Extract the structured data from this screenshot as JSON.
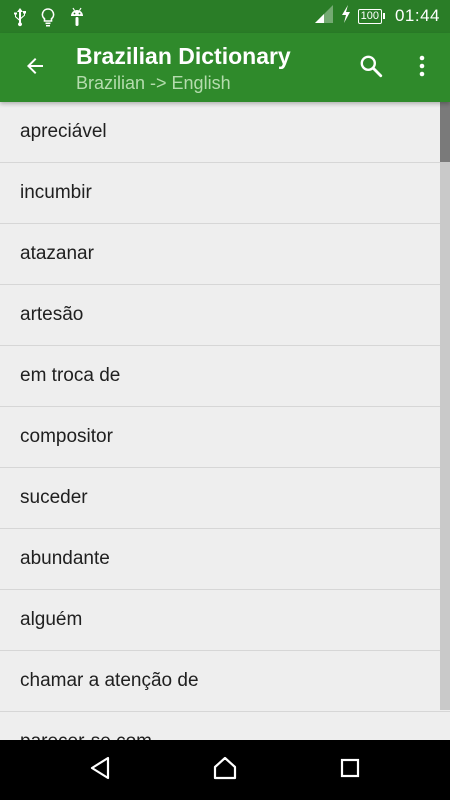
{
  "status_bar": {
    "time": "01:44",
    "battery": "100",
    "left_icons": [
      "usb-icon",
      "lightbulb-icon",
      "android-icon"
    ],
    "right_icons": [
      "signal-icon",
      "charging-bolt-icon",
      "battery-icon"
    ]
  },
  "app_bar": {
    "title": "Brazilian Dictionary",
    "subtitle": "Brazilian -> English",
    "icons": [
      "back-arrow-icon",
      "search-icon",
      "more-vert-icon"
    ]
  },
  "word_list": {
    "items": [
      "apreciável",
      "incumbir",
      "atazanar",
      "artesão",
      "em troca de",
      "compositor",
      "suceder",
      "abundante",
      "alguém",
      "chamar a atenção de",
      "parecer-se com"
    ]
  },
  "nav_bar": {
    "icons": [
      "back-triangle-icon",
      "home-icon",
      "recents-icon"
    ]
  },
  "colors": {
    "status_bar": "#2a7d27",
    "app_bar": "#2f8a2b",
    "subtitle": "#b5dcae",
    "list_background": "#eeeeee",
    "divider": "#d6d6d6",
    "nav_bar": "#000000"
  }
}
